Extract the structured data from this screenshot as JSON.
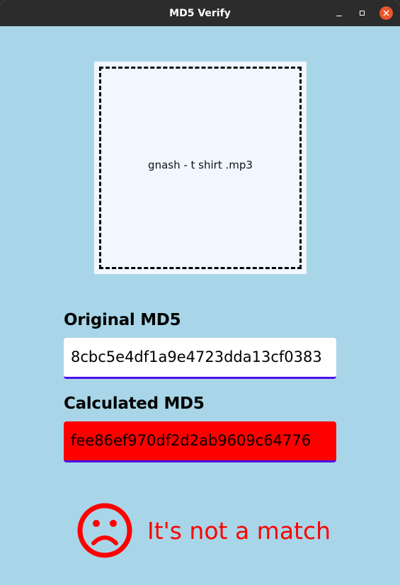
{
  "window": {
    "title": "MD5 Verify"
  },
  "drop_zone": {
    "filename": "gnash - t shirt .mp3"
  },
  "original": {
    "label": "Original MD5",
    "value": "8cbc5e4df1a9e4723dda13cf0383"
  },
  "calculated": {
    "label": "Calculated MD5",
    "value": "fee86ef970df2d2ab9609c64776"
  },
  "result": {
    "text": "It's not a match",
    "icon": "sad-face-icon",
    "color": "#ff0000"
  },
  "colors": {
    "background": "#a8d6e8",
    "titlebar": "#2c2c2c",
    "close_button": "#e9572b",
    "field_underline": "#4a11e8",
    "mismatch": "#ff0000"
  }
}
